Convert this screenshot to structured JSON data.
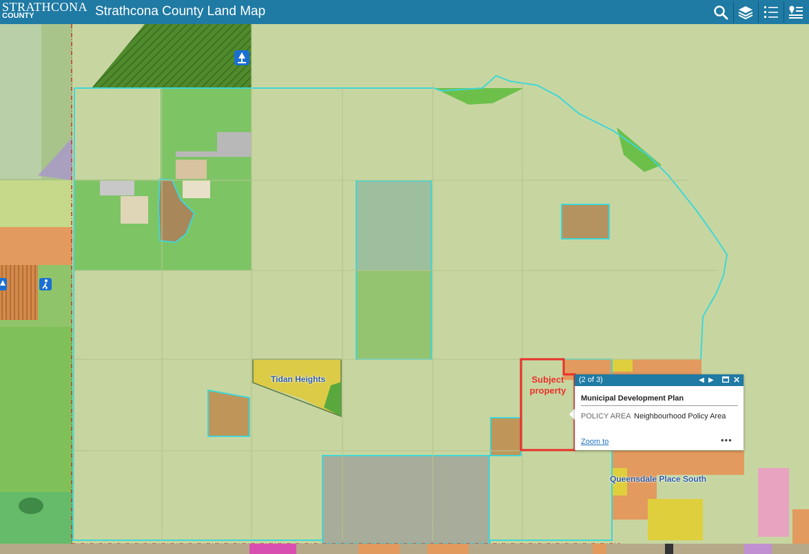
{
  "header": {
    "logo_line1": "STRATHCONA",
    "logo_line2": "COUNTY",
    "title": "Strathcona County Land Map",
    "buttons": [
      {
        "name": "search-icon",
        "tooltip": "Search"
      },
      {
        "name": "layers-icon",
        "tooltip": "Layers"
      },
      {
        "name": "legend-icon",
        "tooltip": "Legend"
      },
      {
        "name": "basemap-icon",
        "tooltip": "Basemap"
      }
    ],
    "color": "#1f7aa4"
  },
  "map": {
    "labels": {
      "tidan_heights": "Tidan Heights",
      "queensdale": "Queensdale Place South",
      "subject": "Subject property"
    },
    "colors": {
      "mdp_boundary": "#3fd6d6",
      "subject_outline": "#e8302a",
      "agriculture": "#c8db95",
      "residential": "#e3c84c",
      "country_residential": "#c49a63",
      "parks": "#6cc04a"
    }
  },
  "popup": {
    "count": "(2 of 3)",
    "title": "Municipal Development Plan",
    "field": "POLICY AREA",
    "value": "Neighbourhood Policy Area",
    "zoom_label": "Zoom to",
    "more": "•••"
  }
}
